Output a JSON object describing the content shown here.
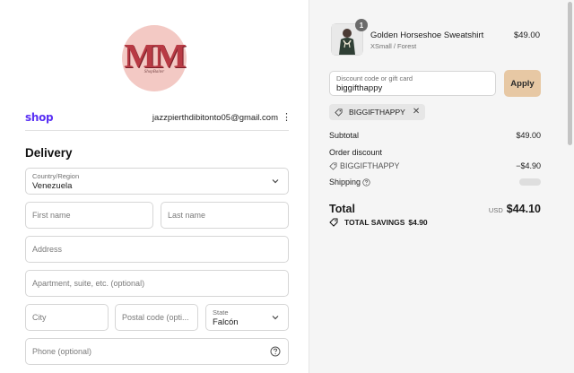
{
  "brand": {
    "logo_text": "MM",
    "logo_subtext": "ShopBaiter"
  },
  "header": {
    "shop_label": "shop",
    "email": "jazzpierthdibitonto05@gmail.com",
    "menu_icon": "kebab-icon"
  },
  "delivery": {
    "heading": "Delivery",
    "country": {
      "label": "Country/Region",
      "value": "Venezuela"
    },
    "first_name": {
      "placeholder": "First name"
    },
    "last_name": {
      "placeholder": "Last name"
    },
    "address": {
      "placeholder": "Address"
    },
    "apartment": {
      "placeholder": "Apartment, suite, etc. (optional)"
    },
    "city": {
      "placeholder": "City"
    },
    "postal": {
      "placeholder": "Postal code (opti..."
    },
    "state": {
      "label": "State",
      "value": "Falcón"
    },
    "phone": {
      "placeholder": "Phone (optional)"
    }
  },
  "summary": {
    "product": {
      "name": "Golden Horseshoe Sweatshirt",
      "variant": "XSmall / Forest",
      "price": "$49.00",
      "quantity": "1"
    },
    "discount_field": {
      "label": "Discount code or gift card",
      "value": "biggifthappy"
    },
    "apply_label": "Apply",
    "applied_code": "BIGGIFTHAPPY",
    "subtotal_label": "Subtotal",
    "subtotal_value": "$49.00",
    "order_discount_label": "Order discount",
    "order_discount_code": "BIGGIFTHAPPY",
    "order_discount_value": "−$4.90",
    "shipping_label": "Shipping",
    "total_label": "Total",
    "total_currency": "USD",
    "total_value": "$44.10",
    "savings_label": "TOTAL SAVINGS",
    "savings_value": "$4.90"
  },
  "colors": {
    "shop_purple": "#5a31f4",
    "apply_button": "#e7c8a4",
    "logo_red": "#b83a44",
    "logo_pink": "#f3c9c4"
  }
}
